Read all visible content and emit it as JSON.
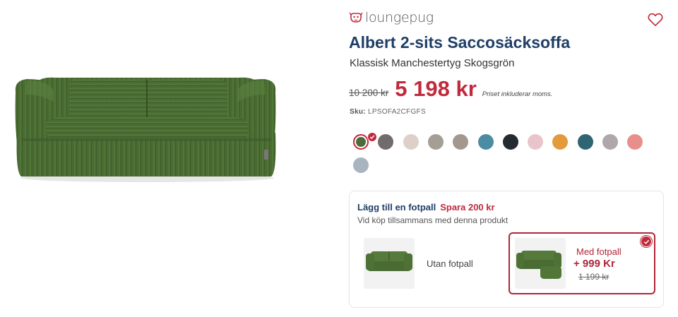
{
  "brand": {
    "name": "loungepug"
  },
  "product": {
    "title": "Albert 2-sits Saccosäcksoffa",
    "subtitle": "Klassisk Manchestertyg Skogsgrön",
    "price_old": "10 200 kr",
    "price_new": "5 198 kr",
    "price_note": "Priset inkluderar moms.",
    "sku_label": "Sku:",
    "sku_value": "LPSOFA2CFGFS"
  },
  "swatches": [
    {
      "color": "#4b6b3a",
      "selected": true
    },
    {
      "color": "#6f6c6b",
      "selected": false
    },
    {
      "color": "#dcd0c8",
      "selected": false
    },
    {
      "color": "#a59e94",
      "selected": false
    },
    {
      "color": "#a29890",
      "selected": false
    },
    {
      "color": "#4b8ca3",
      "selected": false
    },
    {
      "color": "#262a31",
      "selected": false
    },
    {
      "color": "#e9c5cb",
      "selected": false
    },
    {
      "color": "#e39a3d",
      "selected": false
    },
    {
      "color": "#2f6472",
      "selected": false
    },
    {
      "color": "#b0a7a8",
      "selected": false
    },
    {
      "color": "#e88f8c",
      "selected": false
    },
    {
      "color": "#a8b4bf",
      "selected": false
    }
  ],
  "addon": {
    "heading": "Lägg till en fotpall",
    "saving": "Spara 200 kr",
    "subheading": "Vid köp tillsammans med denna produkt",
    "option_without": {
      "label": "Utan fotpall"
    },
    "option_with": {
      "label": "Med fotpall",
      "price": "+ 999 Kr",
      "price_old": "1 199 kr",
      "selected": true
    }
  },
  "colors": {
    "brand_blue": "#1f3e66",
    "accent_red": "#c12a3c",
    "sofa_green": "#4e6e36"
  },
  "icons": [
    "heart-icon",
    "check-icon",
    "pug-logo-icon"
  ]
}
